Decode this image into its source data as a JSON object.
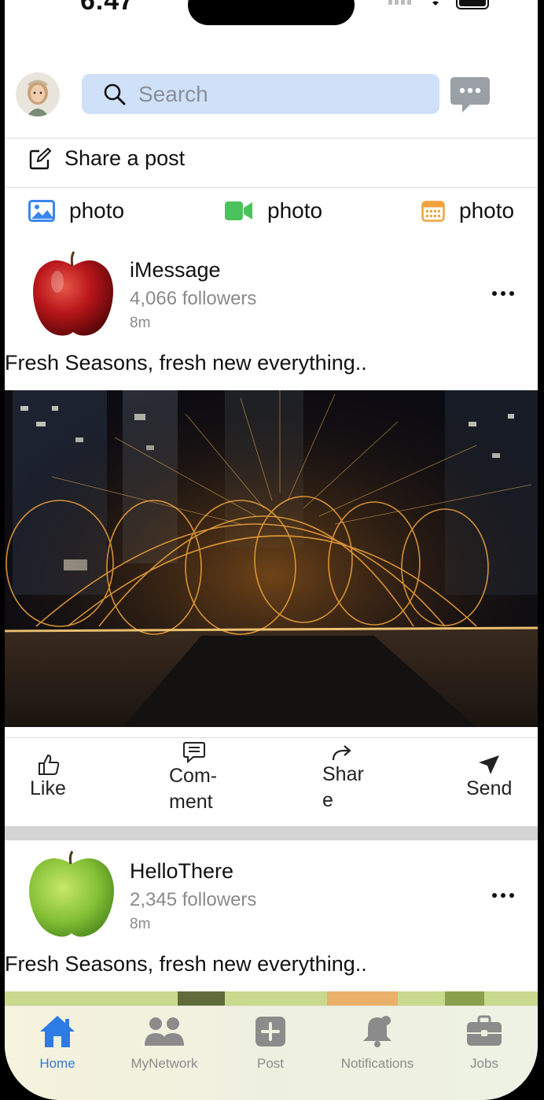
{
  "status_bar": {
    "time": "6:47"
  },
  "header": {
    "search_placeholder": "Search"
  },
  "share": {
    "label": "Share a post"
  },
  "media_options": [
    {
      "icon": "image-icon",
      "label": "photo",
      "color": "#3b86ee"
    },
    {
      "icon": "video-icon",
      "label": "photo",
      "color": "#4cc25c"
    },
    {
      "icon": "calendar-icon",
      "label": "photo",
      "color": "#f0a23c"
    }
  ],
  "posts": [
    {
      "author": "iMessage",
      "followers": "4,066 followers",
      "time": "8m",
      "text": "Fresh Seasons, fresh new everything.."
    },
    {
      "author": "HelloThere",
      "followers": "2,345 followers",
      "time": "8m",
      "text": "Fresh Seasons, fresh new everything.."
    }
  ],
  "actions": {
    "like": "Like",
    "comment_line1": "Com-",
    "comment_line2": "ment",
    "share_line1": "Shar",
    "share_line2": "e",
    "send": "Send"
  },
  "tabs": [
    {
      "label": "Home",
      "icon": "home-icon",
      "active": true
    },
    {
      "label": "MyNetwork",
      "icon": "people-icon",
      "active": false
    },
    {
      "label": "Post",
      "icon": "plus-square-icon",
      "active": false
    },
    {
      "label": "Notifications",
      "icon": "bell-icon",
      "active": false
    },
    {
      "label": "Jobs",
      "icon": "briefcase-icon",
      "active": false
    }
  ],
  "colors": {
    "accent": "#2d7be5",
    "search_bg": "#cfe1f8",
    "tab_inactive": "#8b8b8b"
  }
}
